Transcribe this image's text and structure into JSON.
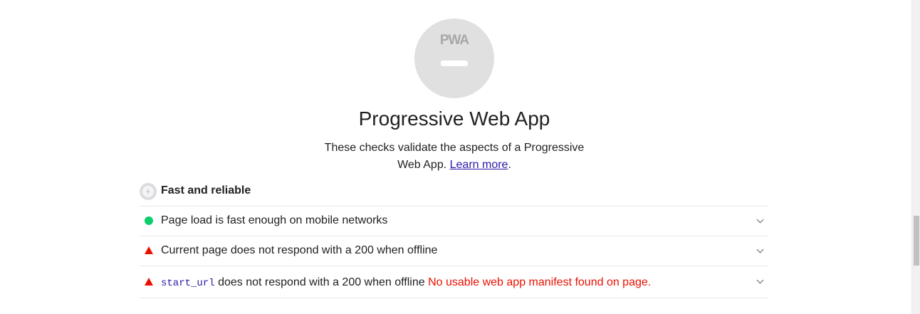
{
  "category": {
    "gauge_logo": "PWA",
    "title": "Progressive Web App",
    "description_prefix": "These checks validate the aspects of a Progressive Web App.",
    "learn_more": "Learn more",
    "description_suffix": "."
  },
  "group": {
    "title": "Fast and reliable",
    "icon": "lightning-bolt-icon"
  },
  "audits": [
    {
      "status": "pass",
      "status_icon": "pass-dot-icon",
      "title": "Page load is fast enough on mobile networks",
      "status_color": "#0cce6b"
    },
    {
      "status": "fail",
      "status_icon": "fail-triangle-icon",
      "title": "Current page does not respond with a 200 when offline",
      "status_color": "#eb0f00"
    },
    {
      "status": "fail",
      "status_icon": "fail-triangle-icon",
      "code": "start_url",
      "title": "does not respond with a 200 when offline",
      "warning": "No usable web app manifest found on page.",
      "status_color": "#eb0f00"
    }
  ],
  "colors": {
    "link": "#2a1aa8",
    "gauge_bg": "#e0e0e0",
    "fail": "#eb0f00",
    "pass": "#0cce6b"
  }
}
